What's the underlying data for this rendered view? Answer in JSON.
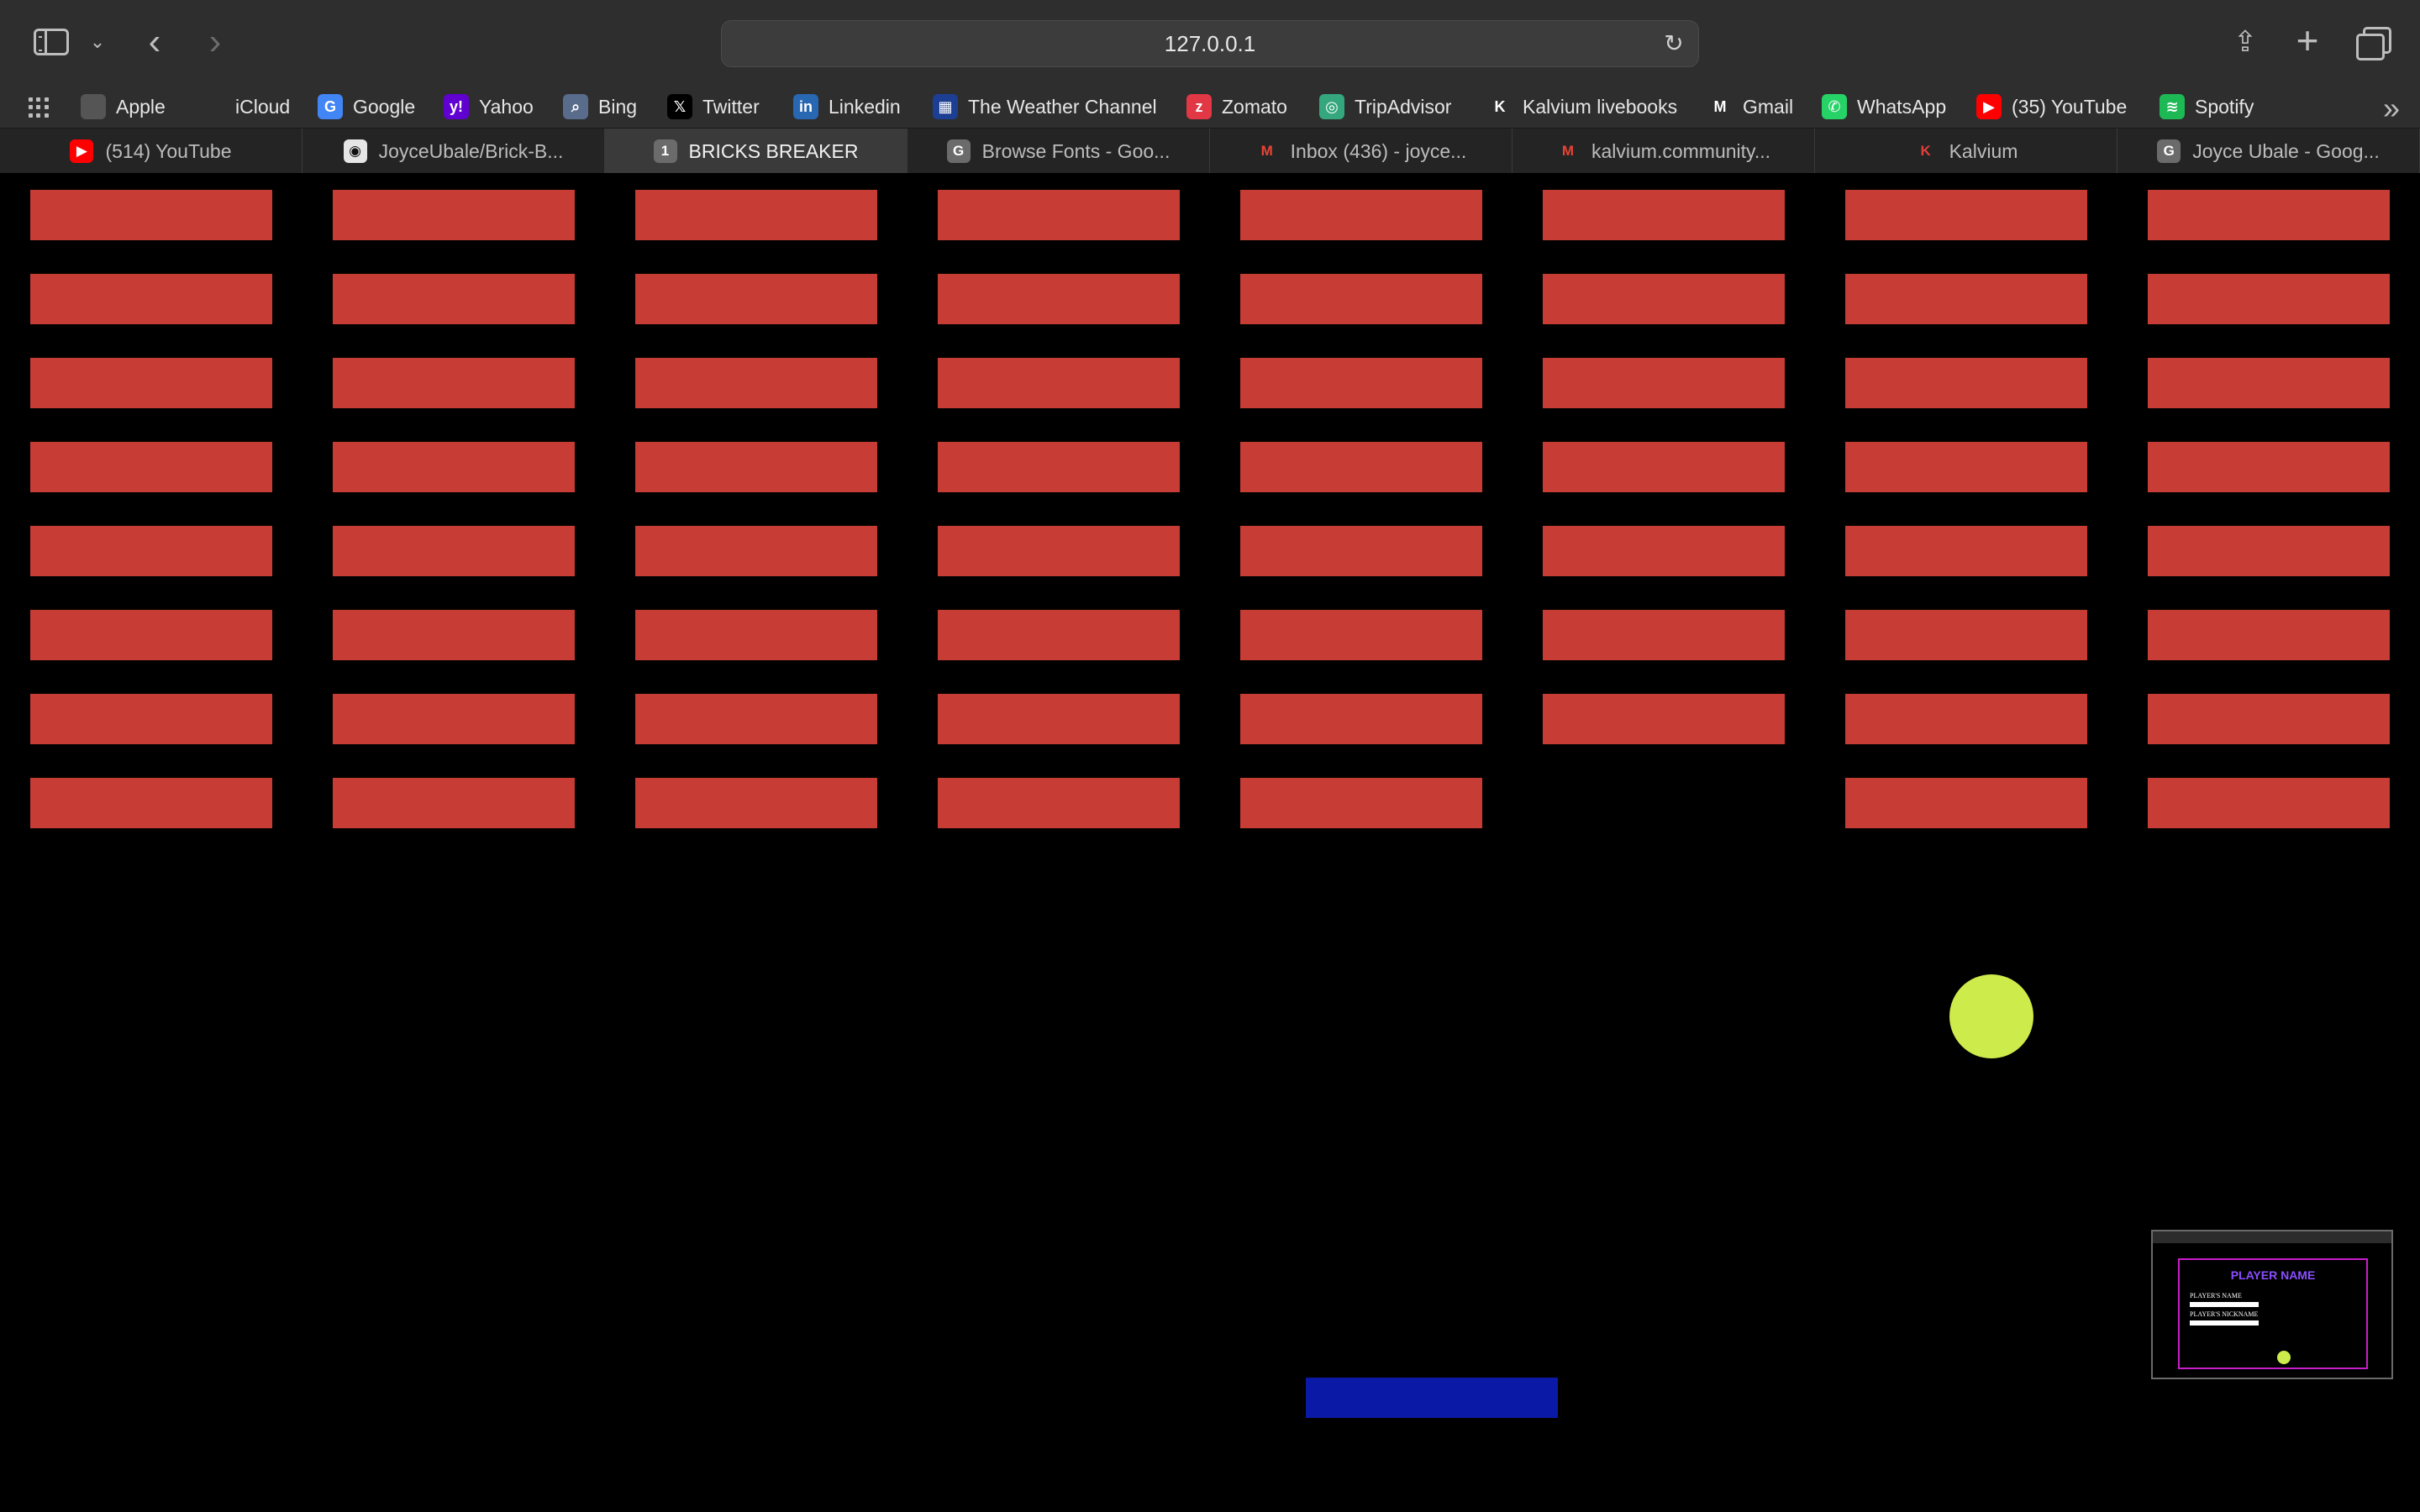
{
  "browser": {
    "url": "127.0.0.1",
    "bookmarks": [
      {
        "label": "Apple",
        "icon": "apple-icon",
        "color": "#555555",
        "glyph": ""
      },
      {
        "label": "iCloud",
        "icon": "apple-icon",
        "color": "#2e2e2e",
        "glyph": ""
      },
      {
        "label": "Google",
        "icon": "google-icon",
        "color": "#4285f4",
        "glyph": "G"
      },
      {
        "label": "Yahoo",
        "icon": "yahoo-icon",
        "color": "#6001d2",
        "glyph": "y!"
      },
      {
        "label": "Bing",
        "icon": "bing-icon",
        "color": "#5a6c8c",
        "glyph": "⌕"
      },
      {
        "label": "Twitter",
        "icon": "x-icon",
        "color": "#000000",
        "glyph": "𝕏"
      },
      {
        "label": "Linkedin",
        "icon": "linkedin-icon",
        "color": "#2867b2",
        "glyph": "in"
      },
      {
        "label": "The Weather Channel",
        "icon": "weather-channel-icon",
        "color": "#1c3f94",
        "glyph": "▦"
      },
      {
        "label": "Zomato",
        "icon": "zomato-icon",
        "color": "#e23744",
        "glyph": "z"
      },
      {
        "label": "TripAdvisor",
        "icon": "tripadvisor-icon",
        "color": "#34a77f",
        "glyph": "◎"
      },
      {
        "label": "Kalvium livebooks",
        "icon": "kalvium-icon",
        "color": "#2e2e2e",
        "glyph": "K"
      },
      {
        "label": "Gmail",
        "icon": "gmail-icon",
        "color": "#2e2e2e",
        "glyph": "M"
      },
      {
        "label": "WhatsApp",
        "icon": "whatsapp-icon",
        "color": "#25d366",
        "glyph": "✆"
      },
      {
        "label": "(35) YouTube",
        "icon": "youtube-icon",
        "color": "#ff0000",
        "glyph": "▶"
      },
      {
        "label": "Spotify",
        "icon": "spotify-icon",
        "color": "#1db954",
        "glyph": "≋"
      }
    ],
    "tabs": [
      {
        "label": "(514) YouTube",
        "icon": "youtube-icon",
        "color": "#ff0000",
        "glyph": "▶",
        "active": false
      },
      {
        "label": "JoyceUbale/Brick-B...",
        "icon": "github-icon",
        "color": "#e6e6e6",
        "glyph": "◉",
        "active": false
      },
      {
        "label": "BRICKS BREAKER",
        "icon": "page-icon",
        "color": "#6b6b6b",
        "glyph": "1",
        "active": true
      },
      {
        "label": "Browse Fonts - Goo...",
        "icon": "google-fonts-icon",
        "color": "#6b6b6b",
        "glyph": "G",
        "active": false
      },
      {
        "label": "Inbox (436) - joyce...",
        "icon": "gmail-icon",
        "color": "#242424",
        "glyph": "M",
        "active": false
      },
      {
        "label": "kalvium.community...",
        "icon": "gmail-icon",
        "color": "#242424",
        "glyph": "M",
        "active": false
      },
      {
        "label": "Kalvium",
        "icon": "kalvium-icon",
        "color": "#242424",
        "glyph": "K",
        "active": false
      },
      {
        "label": "Joyce Ubale - Goog...",
        "icon": "google-icon",
        "color": "#6b6b6b",
        "glyph": "G",
        "active": false
      }
    ]
  },
  "game": {
    "title": "BRICKS BREAKER",
    "brick_color": "#c83c36",
    "ball_color": "#cdeb4b",
    "paddle_color": "#0a1aa6",
    "rows": 8,
    "cols": 8,
    "missing_bricks": [
      [
        7,
        5
      ]
    ],
    "thumbnail": {
      "title": "PLAYER NAME",
      "name_label": "PLAYER'S NAME",
      "nickname_label": "PLAYER'S NICKNAME"
    }
  }
}
